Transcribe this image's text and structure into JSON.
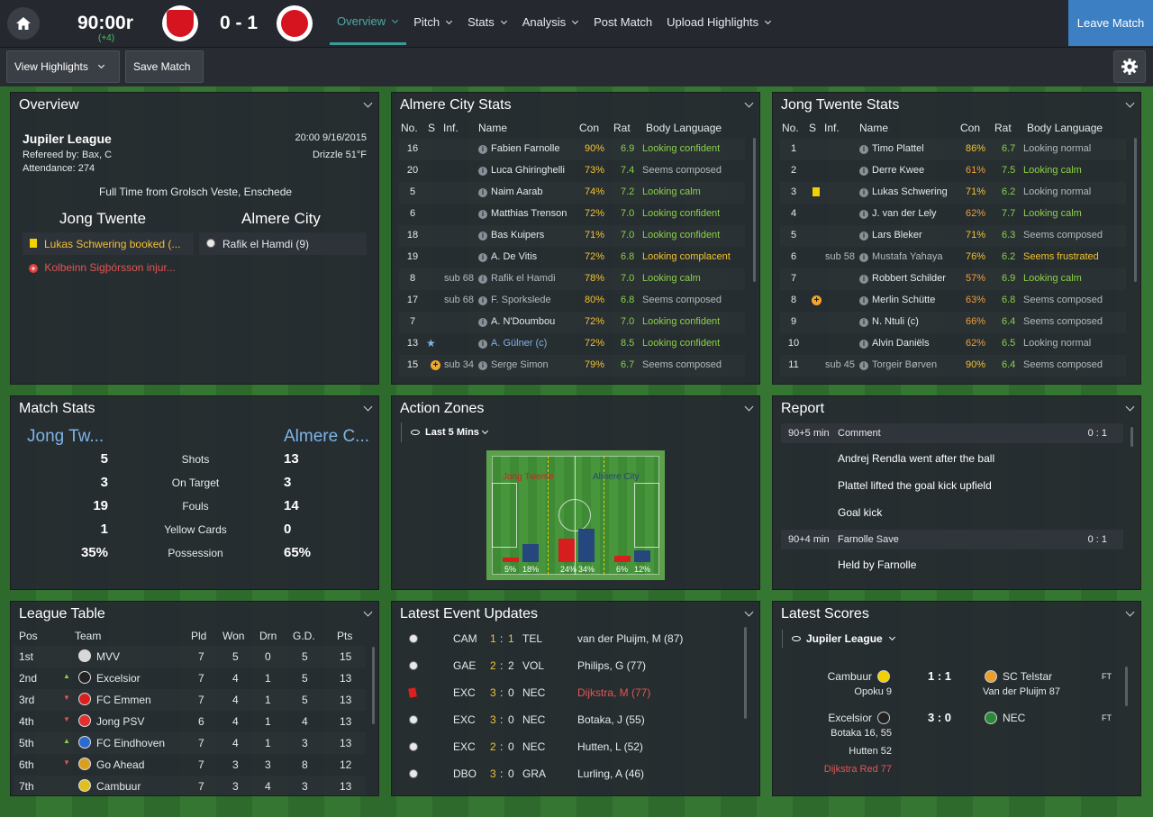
{
  "header": {
    "clock": "90:00r",
    "added_time": "(+4)",
    "score": "0 - 1",
    "nav": [
      {
        "label": "Overview",
        "caret": true,
        "active": true
      },
      {
        "label": "Pitch",
        "caret": true
      },
      {
        "label": "Stats",
        "caret": true
      },
      {
        "label": "Analysis",
        "caret": true
      },
      {
        "label": "Post Match",
        "caret": false
      },
      {
        "label": "Upload Highlights",
        "caret": true
      }
    ],
    "leave_label": "Leave Match"
  },
  "toolbar": {
    "view_highlights": "View Highlights",
    "save_match": "Save Match"
  },
  "overview": {
    "title": "Overview",
    "league": "Jupiler League",
    "datetime": "20:00 9/16/2015",
    "referee": "Refereed by: Bax, C",
    "weather": "Drizzle 51°F",
    "attendance": "Attendance: 274",
    "fulltime": "Full Time from Grolsch Veste, Enschede",
    "home": "Jong Twente",
    "away": "Almere City",
    "home_event": "Lukas Schwering booked (...",
    "away_event": "Rafik el Hamdi (9)",
    "injury": "Kolbeinn Sigþórsson injur..."
  },
  "almere": {
    "title": "Almere City Stats",
    "headers": [
      "No.",
      "S",
      "Inf.",
      "Name",
      "Con",
      "Rat",
      "Body Language"
    ],
    "rows": [
      {
        "no": "16",
        "inf": "",
        "name": "Fabien Farnolle",
        "con": "90%",
        "rat": "6.9",
        "bl": "Looking confident",
        "blc": "grn",
        "icon": ""
      },
      {
        "no": "20",
        "inf": "",
        "name": "Luca Ghiringhelli",
        "con": "73%",
        "rat": "7.4",
        "bl": "Seems composed",
        "blc": "gry",
        "icon": ""
      },
      {
        "no": "5",
        "inf": "",
        "name": "Naim Aarab",
        "con": "74%",
        "rat": "7.2",
        "bl": "Looking calm",
        "blc": "grn",
        "icon": ""
      },
      {
        "no": "6",
        "inf": "",
        "name": "Matthias Trenson",
        "con": "72%",
        "rat": "7.0",
        "bl": "Looking confident",
        "blc": "grn",
        "icon": ""
      },
      {
        "no": "18",
        "inf": "",
        "name": "Bas Kuipers",
        "con": "71%",
        "rat": "7.0",
        "bl": "Looking confident",
        "blc": "grn",
        "icon": ""
      },
      {
        "no": "19",
        "inf": "",
        "name": "A. De Vitis",
        "con": "72%",
        "rat": "6.8",
        "bl": "Looking complacent",
        "blc": "yel",
        "icon": ""
      },
      {
        "no": "8",
        "inf": "sub 68",
        "name": "Rafik el Hamdi",
        "con": "78%",
        "rat": "7.0",
        "bl": "Looking calm",
        "blc": "grn",
        "icon": ""
      },
      {
        "no": "17",
        "inf": "sub 68",
        "name": "F. Sporkslede",
        "con": "80%",
        "rat": "6.8",
        "bl": "Seems composed",
        "blc": "gry",
        "icon": ""
      },
      {
        "no": "7",
        "inf": "",
        "name": "A. N'Doumbou",
        "con": "72%",
        "rat": "7.0",
        "bl": "Looking confident",
        "blc": "grn",
        "icon": ""
      },
      {
        "no": "13",
        "inf": "",
        "name": "A. Gülner (c)",
        "con": "72%",
        "rat": "8.5",
        "bl": "Looking confident",
        "blc": "grn",
        "icon": "star"
      },
      {
        "no": "15",
        "inf": "sub 34",
        "name": "Serge Simon",
        "con": "79%",
        "rat": "6.7",
        "bl": "Seems composed",
        "blc": "gry",
        "icon": "sub"
      }
    ]
  },
  "twente": {
    "title": "Jong Twente Stats",
    "headers": [
      "No.",
      "S",
      "Inf.",
      "Name",
      "Con",
      "Rat",
      "Body Language"
    ],
    "rows": [
      {
        "no": "1",
        "inf": "",
        "name": "Timo Plattel",
        "con": "86%",
        "rat": "6.7",
        "bl": "Looking normal",
        "blc": "gry",
        "icon": ""
      },
      {
        "no": "2",
        "inf": "",
        "name": "Derre Kwee",
        "con": "61%",
        "rat": "7.5",
        "bl": "Looking calm",
        "blc": "grn",
        "icon": ""
      },
      {
        "no": "3",
        "inf": "",
        "name": "Lukas Schwering",
        "con": "71%",
        "rat": "6.2",
        "bl": "Looking normal",
        "blc": "gry",
        "icon": "yellow"
      },
      {
        "no": "4",
        "inf": "",
        "name": "J. van der Lely",
        "con": "62%",
        "rat": "7.7",
        "bl": "Looking calm",
        "blc": "grn",
        "icon": ""
      },
      {
        "no": "5",
        "inf": "",
        "name": "Lars Bleker",
        "con": "71%",
        "rat": "6.3",
        "bl": "Seems composed",
        "blc": "gry",
        "icon": ""
      },
      {
        "no": "6",
        "inf": "sub 58",
        "name": "Mustafa Yahaya",
        "con": "76%",
        "rat": "6.2",
        "bl": "Seems frustrated",
        "blc": "yel",
        "icon": ""
      },
      {
        "no": "7",
        "inf": "",
        "name": "Robbert Schilder",
        "con": "57%",
        "rat": "6.9",
        "bl": "Looking calm",
        "blc": "grn",
        "icon": ""
      },
      {
        "no": "8",
        "inf": "",
        "name": "Merlin Schütte",
        "con": "63%",
        "rat": "6.8",
        "bl": "Seems composed",
        "blc": "gry",
        "icon": "sub"
      },
      {
        "no": "9",
        "inf": "",
        "name": "N. Ntuli (c)",
        "con": "66%",
        "rat": "6.4",
        "bl": "Seems composed",
        "blc": "gry",
        "icon": ""
      },
      {
        "no": "10",
        "inf": "",
        "name": "Alvin Daniëls",
        "con": "62%",
        "rat": "6.5",
        "bl": "Looking normal",
        "blc": "gry",
        "icon": ""
      },
      {
        "no": "11",
        "inf": "sub 45",
        "name": "Torgeir Børven",
        "con": "90%",
        "rat": "6.4",
        "bl": "Seems composed",
        "blc": "gry",
        "icon": ""
      }
    ]
  },
  "match_stats": {
    "title": "Match Stats",
    "home": "Jong Tw...",
    "away": "Almere C...",
    "rows": [
      {
        "home": "5",
        "label": "Shots",
        "away": "13"
      },
      {
        "home": "3",
        "label": "On Target",
        "away": "3"
      },
      {
        "home": "19",
        "label": "Fouls",
        "away": "14"
      },
      {
        "home": "1",
        "label": "Yellow Cards",
        "away": "0"
      },
      {
        "home": "35%",
        "label": "Possession",
        "away": "65%"
      }
    ]
  },
  "action_zones": {
    "title": "Action Zones",
    "filter": "Last 5 Mins",
    "home": "Jong Twente",
    "away": "Almere City",
    "zones": [
      {
        "home": 5,
        "away": 18,
        "home_label": "5%",
        "away_label": "18%"
      },
      {
        "home": 24,
        "away": 34,
        "home_label": "24%",
        "away_label": "34%"
      },
      {
        "home": 6,
        "away": 12,
        "home_label": "6%",
        "away_label": "12%"
      }
    ]
  },
  "report": {
    "title": "Report",
    "items": [
      {
        "type": "header",
        "time": "90+5 min",
        "label": "Comment",
        "score": "0 : 1"
      },
      {
        "type": "text",
        "text": "Andrej Rendla went after the ball"
      },
      {
        "type": "text",
        "text": "Plattel lifted the goal kick upfield"
      },
      {
        "type": "text",
        "text": "Goal kick"
      },
      {
        "type": "header",
        "time": "90+4 min",
        "label": "Farnolle Save",
        "score": "0 : 1"
      },
      {
        "type": "text",
        "text": "Held by Farnolle"
      }
    ]
  },
  "league_table": {
    "title": "League Table",
    "headers": [
      "Pos",
      "Team",
      "Pld",
      "Won",
      "Drn",
      "G.D.",
      "Pts"
    ],
    "rows": [
      {
        "pos": "1st",
        "team": "MVV",
        "pld": "7",
        "won": "5",
        "drn": "0",
        "gd": "5",
        "pts": "15",
        "move": "",
        "color": "#d8d8d8"
      },
      {
        "pos": "2nd",
        "team": "Excelsior",
        "pld": "7",
        "won": "4",
        "drn": "1",
        "gd": "5",
        "pts": "13",
        "move": "up",
        "color": "#222222"
      },
      {
        "pos": "3rd",
        "team": "FC Emmen",
        "pld": "7",
        "won": "4",
        "drn": "1",
        "gd": "5",
        "pts": "13",
        "move": "down",
        "color": "#d82020"
      },
      {
        "pos": "4th",
        "team": "Jong PSV",
        "pld": "6",
        "won": "4",
        "drn": "1",
        "gd": "4",
        "pts": "13",
        "move": "down",
        "color": "#e03030"
      },
      {
        "pos": "5th",
        "team": "FC Eindhoven",
        "pld": "7",
        "won": "4",
        "drn": "1",
        "gd": "3",
        "pts": "13",
        "move": "up",
        "color": "#2a6bd0"
      },
      {
        "pos": "6th",
        "team": "Go Ahead",
        "pld": "7",
        "won": "3",
        "drn": "3",
        "gd": "8",
        "pts": "12",
        "move": "down",
        "color": "#d8a020"
      },
      {
        "pos": "7th",
        "team": "Cambuur",
        "pld": "7",
        "won": "3",
        "drn": "4",
        "gd": "3",
        "pts": "13",
        "move": "",
        "color": "#e0c020"
      }
    ]
  },
  "events": {
    "title": "Latest Event Updates",
    "rows": [
      {
        "home": "CAM",
        "hs": "1",
        "sep": ":",
        "as": "1",
        "away": "TEL",
        "desc": "van der Pluijm, M (87)",
        "type": "goal",
        "descColor": "#e6e9ec"
      },
      {
        "home": "GAE",
        "hs": "2",
        "sep": ":",
        "as": "2",
        "away": "VOL",
        "desc": "Philips, G (77)",
        "type": "goal",
        "descColor": "#e6e9ec"
      },
      {
        "home": "EXC",
        "hs": "3",
        "sep": ":",
        "as": "0",
        "away": "NEC",
        "desc": "Dijkstra, M (77)",
        "type": "red",
        "descColor": "#e25555"
      },
      {
        "home": "EXC",
        "hs": "3",
        "sep": ":",
        "as": "0",
        "away": "NEC",
        "desc": "Botaka, J (55)",
        "type": "goal",
        "descColor": "#e6e9ec"
      },
      {
        "home": "EXC",
        "hs": "2",
        "sep": ":",
        "as": "0",
        "away": "NEC",
        "desc": "Hutten, L (52)",
        "type": "goal",
        "descColor": "#e6e9ec"
      },
      {
        "home": "DBO",
        "hs": "3",
        "sep": ":",
        "as": "0",
        "away": "GRA",
        "desc": "Lurling, A (46)",
        "type": "goal",
        "descColor": "#e6e9ec"
      }
    ]
  },
  "latest_scores": {
    "title": "Latest Scores",
    "filter": "Jupiler League",
    "games": [
      {
        "home": "Cambuur",
        "score": "1 : 1",
        "away": "SC Telstar",
        "status": "FT",
        "home_scorers": [
          "Opoku 9"
        ],
        "away_scorers": [
          "Van der Pluijm 87"
        ]
      },
      {
        "home": "Excelsior",
        "score": "3 : 0",
        "away": "NEC",
        "status": "FT",
        "home_scorers": [
          "Botaka 16, 55",
          "Hutten 52",
          "Dijkstra Red 77"
        ],
        "away_scorers": []
      }
    ]
  }
}
